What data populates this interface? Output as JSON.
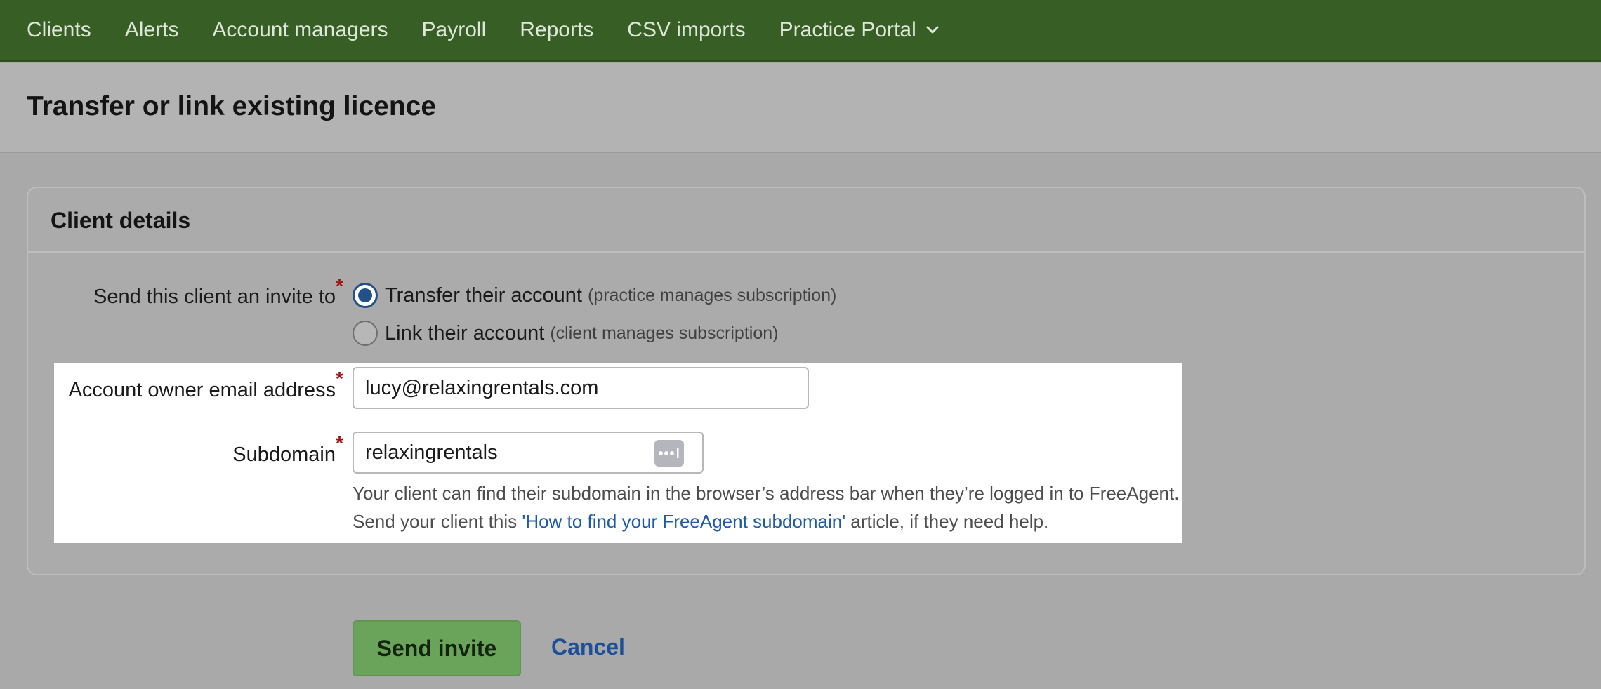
{
  "nav": {
    "items": [
      {
        "label": "Clients"
      },
      {
        "label": "Alerts"
      },
      {
        "label": "Account managers"
      },
      {
        "label": "Payroll"
      },
      {
        "label": "Reports"
      },
      {
        "label": "CSV imports"
      },
      {
        "label": "Practice Portal",
        "icon": "chevron-down-icon"
      }
    ]
  },
  "page": {
    "title": "Transfer or link existing licence"
  },
  "card": {
    "title": "Client details"
  },
  "invite": {
    "label": "Send this client an invite to",
    "required_mark": "*",
    "options": [
      {
        "label": "Transfer their account",
        "hint": "(practice manages subscription)",
        "selected": true
      },
      {
        "label": "Link their account",
        "hint": "(client manages subscription)",
        "selected": false
      }
    ]
  },
  "email": {
    "label": "Account owner email address",
    "required_mark": "*",
    "value": "lucy@relaxingrentals.com"
  },
  "subdomain": {
    "label": "Subdomain",
    "required_mark": "*",
    "value": "relaxingrentals",
    "icon": "password-manager-icon",
    "help_line1": "Your client can find their subdomain in the browser’s address bar when they’re logged in to FreeAgent.",
    "help_line2_prefix": "Send your client this ",
    "help_link": "'How to find your FreeAgent subdomain'",
    "help_line2_suffix": " article, if they need help."
  },
  "actions": {
    "send_label": "Send invite",
    "cancel_label": "Cancel"
  },
  "colors": {
    "nav_bg": "#375e25",
    "primary_button": "#6aa35a",
    "link": "#1d5aa8",
    "radio_selected": "#24508a",
    "required": "#a01616"
  }
}
